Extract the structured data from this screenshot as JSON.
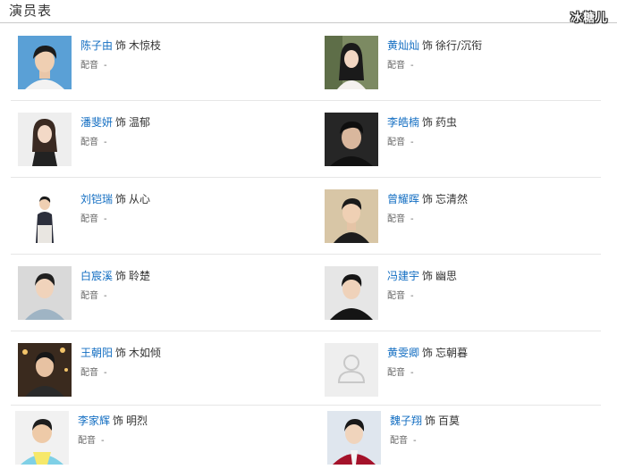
{
  "header": {
    "title": "演员表",
    "watermark": "冰糖儿"
  },
  "labels": {
    "shi": "饰",
    "voice": "配音"
  },
  "cast": [
    {
      "actor": "陈子由",
      "role": "木惊枝",
      "voice": "-"
    },
    {
      "actor": "黄灿灿",
      "role": "徐行/沉衔",
      "voice": "-"
    },
    {
      "actor": "潘斐妍",
      "role": "温郁",
      "voice": "-"
    },
    {
      "actor": "李皓楠",
      "role": "药虫",
      "voice": "-"
    },
    {
      "actor": "刘铠瑞",
      "role": "从心",
      "voice": "-"
    },
    {
      "actor": "曾耀晖",
      "role": "忘清然",
      "voice": "-"
    },
    {
      "actor": "白宸溪",
      "role": "聆楚",
      "voice": "-"
    },
    {
      "actor": "冯建宇",
      "role": "幽思",
      "voice": "-"
    },
    {
      "actor": "王朝阳",
      "role": "木如倾",
      "voice": "-"
    },
    {
      "actor": "黄雯卿",
      "role": "忘朝暮",
      "voice": "-"
    },
    {
      "actor": "李家辉",
      "role": "明烈",
      "voice": "-"
    },
    {
      "actor": "魏子翔",
      "role": "百莫",
      "voice": "-"
    }
  ]
}
